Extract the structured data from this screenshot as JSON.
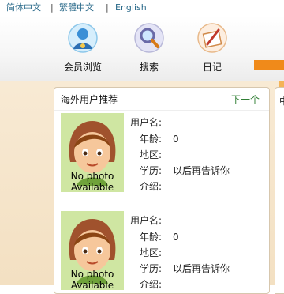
{
  "lang": {
    "simplified": "简体中文",
    "traditional": "繁體中文",
    "english": "English",
    "separator": "|"
  },
  "nav": {
    "items": [
      {
        "label": "会员浏览",
        "icon": "member-browse-icon"
      },
      {
        "label": "搜索",
        "icon": "search-magnifier-icon"
      },
      {
        "label": "日记",
        "icon": "diary-notebook-icon"
      }
    ]
  },
  "panel": {
    "title": "海外用户推荐",
    "more": "下一个",
    "right_title": "中"
  },
  "users": [
    {
      "photo_text_1": "No photo",
      "photo_text_2": "Available",
      "username_label": "用户名:",
      "username_value": "",
      "age_label": "年龄:",
      "age_value": "0",
      "region_label": "地区:",
      "region_value": "",
      "education_label": "学历:",
      "education_value": "以后再告诉你",
      "intro_label": "介绍:",
      "intro_value": ""
    },
    {
      "photo_text_1": "No photo",
      "photo_text_2": "Available",
      "username_label": "用户名:",
      "username_value": "",
      "age_label": "年龄:",
      "age_value": "0",
      "region_label": "地区:",
      "region_value": "",
      "education_label": "学历:",
      "education_value": "以后再告诉你",
      "intro_label": "介绍:",
      "intro_value": ""
    }
  ],
  "colors": {
    "accent": "#f08a1a",
    "more_link": "#2e7d32",
    "photo_bg": "#cfe6a2"
  }
}
